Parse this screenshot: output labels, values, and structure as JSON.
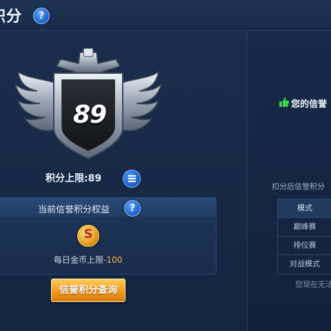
{
  "header": {
    "title": "积分",
    "help_icon": "?"
  },
  "badge": {
    "score": "89",
    "icon": "silver-winged-shield-badge"
  },
  "score_limit": {
    "label": "积分上限:89"
  },
  "benefits": {
    "title": "当前信誉积分权益",
    "help_icon": "?",
    "coin_symbol": "S",
    "coin_text_prefix": "每日金币上限",
    "coin_text_value": "-100"
  },
  "query_button": {
    "label": "信誉积分查询"
  },
  "right_panel": {
    "credit_message": "您的信誉",
    "deduct_text": "扣分后信誉积分",
    "mode_table": {
      "header": "模式",
      "rows": [
        "巅峰赛",
        "排位赛",
        "对战模式"
      ]
    },
    "footer_text": "您现在无法"
  },
  "colors": {
    "background": "#172a46",
    "accent_blue": "#1e5fc9",
    "button_orange": "#f19a1a",
    "coin_value": "#ffb94a",
    "thumb_green": "#3fd147"
  }
}
